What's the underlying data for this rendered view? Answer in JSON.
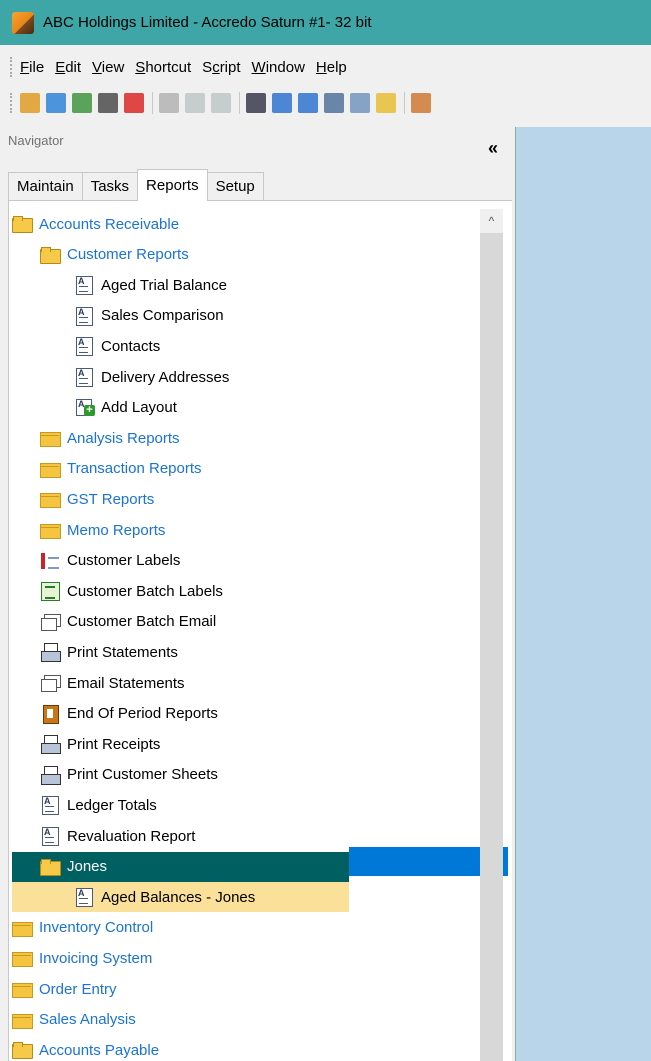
{
  "window": {
    "title": "ABC Holdings Limited - Accredo Saturn #1- 32 bit"
  },
  "menu": [
    {
      "label": "File",
      "ul": "F",
      "rest": "ile"
    },
    {
      "label": "Edit",
      "ul": "E",
      "rest": "dit"
    },
    {
      "label": "View",
      "ul": "V",
      "rest": "iew"
    },
    {
      "label": "Shortcut",
      "ul": "S",
      "rest": "hortcut"
    },
    {
      "label": "Script",
      "pre": "S",
      "ul": "c",
      "rest": "ript"
    },
    {
      "label": "Window",
      "ul": "W",
      "rest": "indow"
    },
    {
      "label": "Help",
      "ul": "H",
      "rest": "elp"
    }
  ],
  "toolbar_icons": [
    "open-folder-icon",
    "home-icon",
    "refresh-icon",
    "camera-icon",
    "close-icon",
    "cut-icon",
    "copy-icon",
    "paste-icon",
    "calculator-icon",
    "calendar-icon",
    "properties-icon",
    "print-preview-icon",
    "zoom-icon",
    "note-icon",
    "edit-icon"
  ],
  "navigator": {
    "header": "Navigator",
    "collapse": "«",
    "tabs": [
      "Maintain",
      "Tasks",
      "Reports",
      "Setup"
    ],
    "active_tab": "Reports"
  },
  "tree": [
    {
      "label": "Accounts Receivable",
      "icon": "folder-open",
      "level": 0,
      "link": true
    },
    {
      "label": "Customer Reports",
      "icon": "folder-open",
      "level": 1,
      "link": true
    },
    {
      "label": "Aged Trial Balance",
      "icon": "doc",
      "level": 2
    },
    {
      "label": "Sales Comparison",
      "icon": "doc",
      "level": 2
    },
    {
      "label": "Contacts",
      "icon": "doc",
      "level": 2
    },
    {
      "label": "Delivery Addresses",
      "icon": "doc",
      "level": 2
    },
    {
      "label": "Add Layout",
      "icon": "add",
      "level": 2
    },
    {
      "label": "Analysis Reports",
      "icon": "folder",
      "level": 1,
      "link": true
    },
    {
      "label": "Transaction Reports",
      "icon": "folder",
      "level": 1,
      "link": true
    },
    {
      "label": "GST Reports",
      "icon": "folder",
      "level": 1,
      "link": true
    },
    {
      "label": "Memo Reports",
      "icon": "folder",
      "level": 1,
      "link": true
    },
    {
      "label": "Customer Labels",
      "icon": "label",
      "level": 1
    },
    {
      "label": "Customer Batch Labels",
      "icon": "batch",
      "level": 1
    },
    {
      "label": "Customer Batch Email",
      "icon": "email",
      "level": 1
    },
    {
      "label": "Print Statements",
      "icon": "print",
      "level": 1
    },
    {
      "label": "Email Statements",
      "icon": "email",
      "level": 1
    },
    {
      "label": "End Of Period Reports",
      "icon": "eop",
      "level": 1
    },
    {
      "label": "Print Receipts",
      "icon": "print",
      "level": 1
    },
    {
      "label": "Print Customer Sheets",
      "icon": "print",
      "level": 1
    },
    {
      "label": "Ledger Totals",
      "icon": "doc",
      "level": 1
    },
    {
      "label": "Revaluation Report",
      "icon": "doc",
      "level": 1
    },
    {
      "label": "Jones",
      "icon": "folder-open",
      "level": 1,
      "selected": true
    },
    {
      "label": "Aged Balances - Jones",
      "icon": "doc",
      "level": 2,
      "highlight": true
    },
    {
      "label": "Inventory Control",
      "icon": "folder",
      "level": 0,
      "link": true
    },
    {
      "label": "Invoicing System",
      "icon": "folder",
      "level": 0,
      "link": true
    },
    {
      "label": "Order Entry",
      "icon": "folder",
      "level": 0,
      "link": true
    },
    {
      "label": "Sales Analysis",
      "icon": "folder",
      "level": 0,
      "link": true
    },
    {
      "label": "Accounts Payable",
      "icon": "folder-open",
      "level": 0,
      "link": true
    }
  ],
  "scroll_up": "^"
}
